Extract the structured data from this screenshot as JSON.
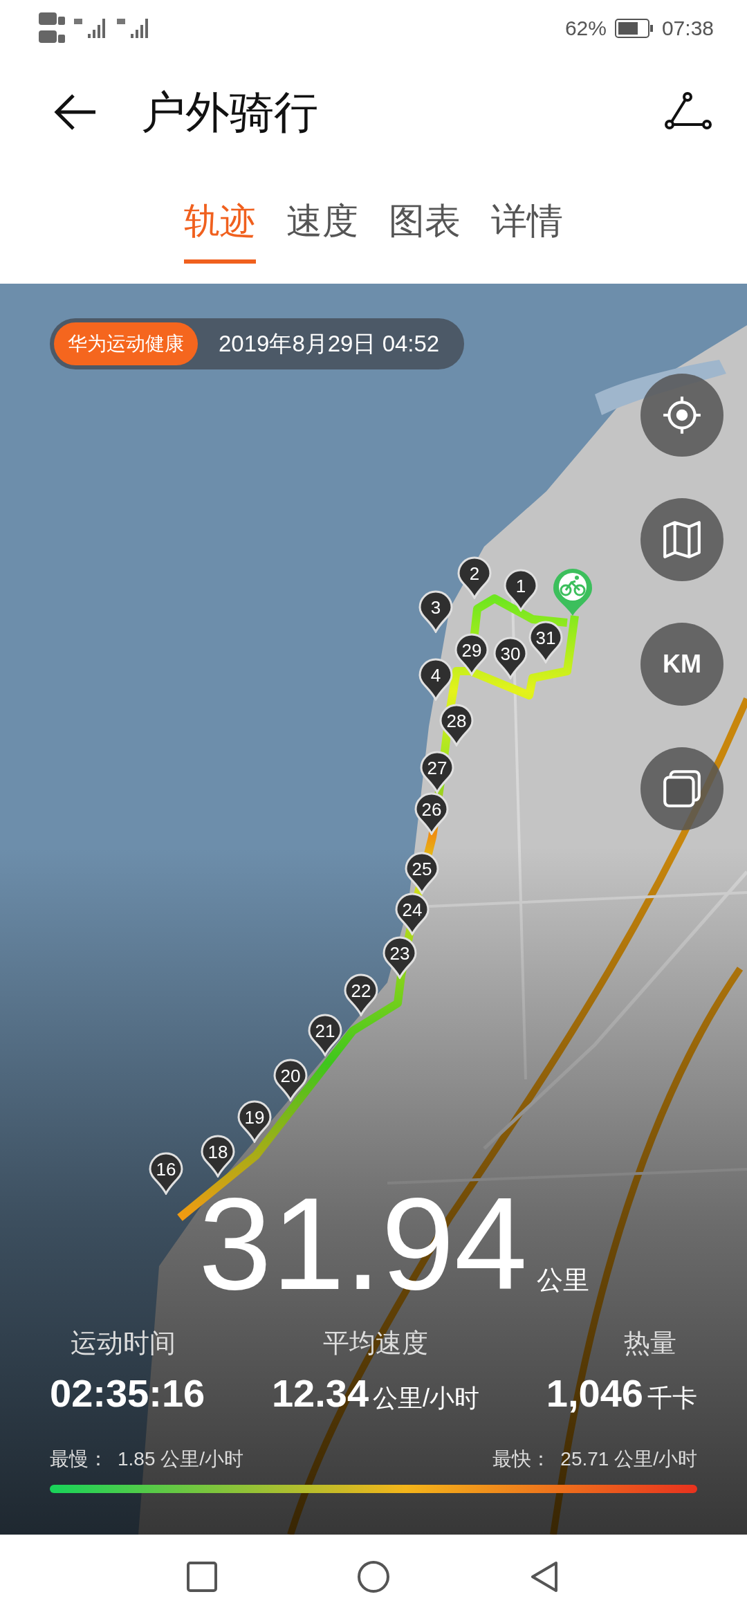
{
  "status_bar": {
    "battery": "62%",
    "time": "07:38"
  },
  "header": {
    "title": "户外骑行"
  },
  "tabs": [
    {
      "label": "轨迹",
      "selected": true
    },
    {
      "label": "速度",
      "selected": false
    },
    {
      "label": "图表",
      "selected": false
    },
    {
      "label": "详情",
      "selected": false
    }
  ],
  "map": {
    "badge": "华为运动健康",
    "date": "2019年8月29日 04:52",
    "controls": [
      {
        "kind": "locate"
      },
      {
        "kind": "map"
      },
      {
        "kind": "units",
        "label": "KM"
      },
      {
        "kind": "layers"
      }
    ],
    "markers": [
      {
        "label": "2"
      },
      {
        "label": "1"
      },
      {
        "label": "3"
      },
      {
        "label": "31"
      },
      {
        "label": "29"
      },
      {
        "label": "30"
      },
      {
        "label": "4"
      },
      {
        "label": "28"
      },
      {
        "label": "27"
      },
      {
        "label": "26"
      },
      {
        "label": "25"
      },
      {
        "label": "24"
      },
      {
        "label": "23"
      },
      {
        "label": "22"
      },
      {
        "label": "21"
      },
      {
        "label": "20"
      },
      {
        "label": "19"
      },
      {
        "label": "18"
      },
      {
        "label": "16"
      }
    ],
    "distance": {
      "value": "31.94",
      "unit": "公里"
    },
    "stats": [
      {
        "label": "运动时间",
        "value": "02:35:16"
      },
      {
        "label": "平均速度",
        "value": "12.34",
        "unit": "公里/小时"
      },
      {
        "label": "热量",
        "value": "1,046",
        "unit": "千卡"
      }
    ],
    "speed_range": {
      "min_label": "最慢：",
      "min": "1.85 公里/小时",
      "max_label": "最快：",
      "max": "25.71 公里/小时"
    }
  }
}
